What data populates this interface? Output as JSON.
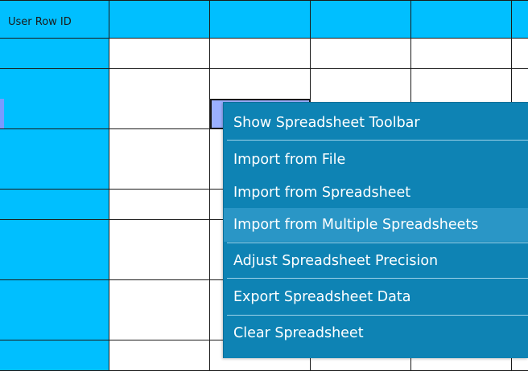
{
  "spreadsheet": {
    "header_label": "User Row ID",
    "column_count": 6,
    "row_count": 11,
    "header_color": "#00bfff",
    "active_cell_color": "#9ab0ff"
  },
  "context_menu": {
    "background_color": "#0e83b4",
    "highlight_color": "#2a96c6",
    "items": [
      {
        "label": "Show Spreadsheet Toolbar",
        "highlighted": false
      },
      {
        "label": "Import from File",
        "highlighted": false
      },
      {
        "label": "Import from Spreadsheet",
        "highlighted": false
      },
      {
        "label": "Import from Multiple Spreadsheets",
        "highlighted": true
      },
      {
        "label": "Adjust Spreadsheet Precision",
        "highlighted": false
      },
      {
        "label": "Export Spreadsheet Data",
        "highlighted": false
      },
      {
        "label": "Clear Spreadsheet",
        "highlighted": false
      }
    ]
  }
}
